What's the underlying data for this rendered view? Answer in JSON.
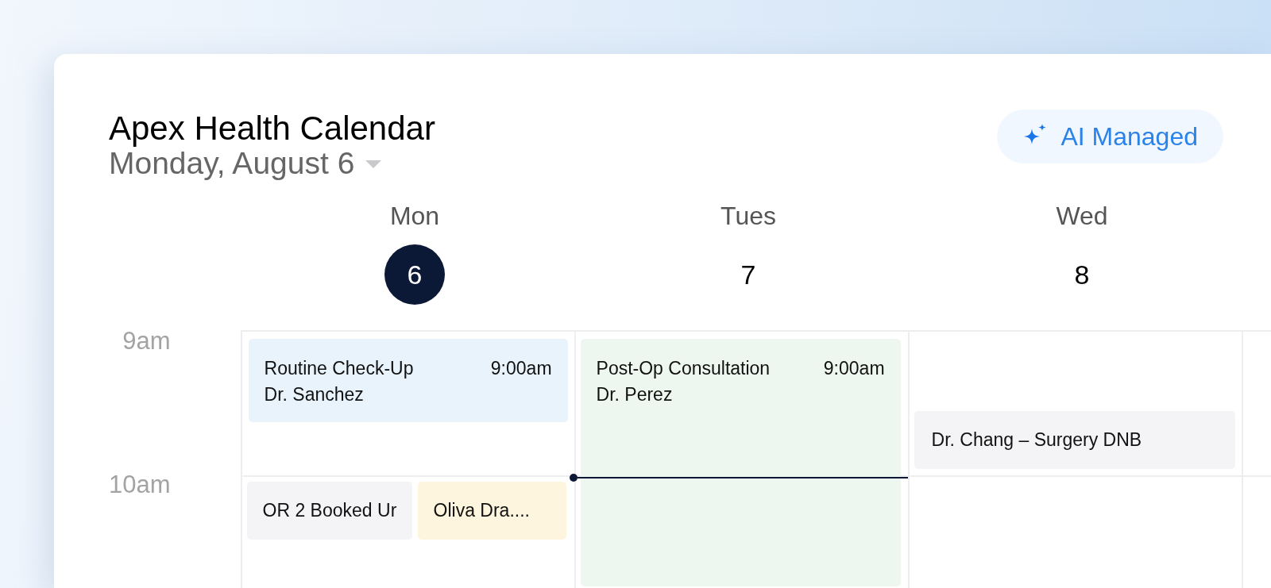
{
  "title": "Apex Health Calendar",
  "date_picker": {
    "label": "Monday, August 6"
  },
  "ai_button": {
    "label": "AI Managed"
  },
  "current_time_line": true,
  "time_labels": [
    "9am",
    "10am"
  ],
  "days": [
    {
      "name": "Mon",
      "date": "6",
      "selected": true,
      "events": [
        {
          "kind": "appointment",
          "title": "Routine Check-Up",
          "time": "9:00am",
          "doctor": "Dr. Sanchez",
          "color": "#e8f3fc"
        },
        {
          "kind": "block",
          "title": "OR 2 Booked Ur",
          "color": "#f4f4f6"
        },
        {
          "kind": "block",
          "title": "Oliva Dra....",
          "color": "#fdf5dd"
        }
      ]
    },
    {
      "name": "Tues",
      "date": "7",
      "selected": false,
      "events": [
        {
          "kind": "appointment",
          "title": "Post-Op Consultation",
          "time": "9:00am",
          "doctor": "Dr. Perez",
          "color": "#edf7ef"
        }
      ]
    },
    {
      "name": "Wed",
      "date": "8",
      "selected": false,
      "events": [
        {
          "kind": "block",
          "title": "Dr. Chang – Surgery DNB",
          "color": "#f4f4f6"
        }
      ]
    }
  ]
}
